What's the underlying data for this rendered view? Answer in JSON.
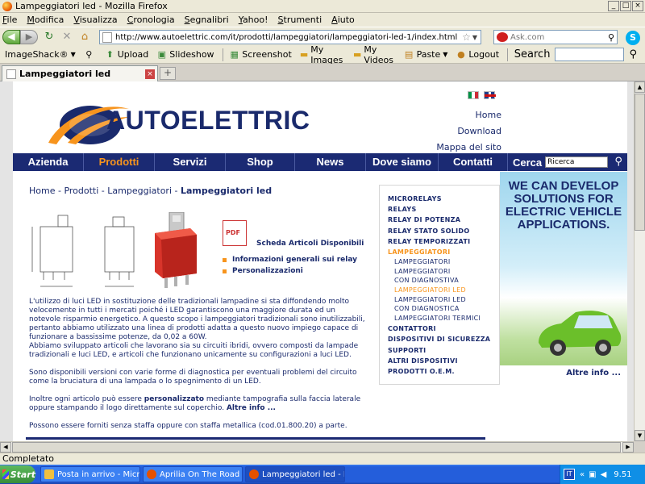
{
  "window": {
    "title": "Lampeggiatori led - Mozilla Firefox",
    "controls": [
      "_",
      "□",
      "×"
    ]
  },
  "menu": [
    "File",
    "Modifica",
    "Visualizza",
    "Cronologia",
    "Segnalibri",
    "Yahoo!",
    "Strumenti",
    "Aiuto"
  ],
  "nav": {
    "url": "http://www.autoelettric.com/it/prodotti/lampeggiatori/lampeggiatori-led-1/index.html",
    "ask_placeholder": "Ask.com"
  },
  "toolbar": {
    "items": [
      "ImageShack®",
      "Upload",
      "Slideshow",
      "Screenshot",
      "My Images",
      "My Videos",
      "Paste",
      "Logout"
    ],
    "search_label": "Search"
  },
  "tab": {
    "label": "Lampeggiatori led"
  },
  "site": {
    "logo_text": "AUTOELETTRIC",
    "top_links": [
      "Home",
      "Download",
      "Mappa del sito"
    ],
    "main_nav": [
      "Azienda",
      "Prodotti",
      "Servizi",
      "Shop",
      "News",
      "Dove siamo",
      "Contatti"
    ],
    "search_label": "Cerca",
    "search_value": "Ricerca",
    "breadcrumb": {
      "items": [
        "Home",
        "Prodotti",
        "Lampeggiatori"
      ],
      "current": "Lampeggiatori led",
      "sep": " - "
    },
    "scheda": "Scheda Articoli Disponibili",
    "bullets": [
      "Informazioni generali sui relay",
      "Personalizzazioni"
    ],
    "paragraphs": [
      "L'utilizzo di luci LED in sostituzione delle tradizionali lampadine si sta diffondendo molto velocemente in tutti i mercati poiché i LED garantiscono una maggiore durata ed un notevole risparmio energetico. A questo scopo i lampeggiatori tradizionali sono inutilizzabili, pertanto abbiamo utilizzato una linea di prodotti adatta a questo nuovo impiego capace di funzionare a bassissime potenze, da 0,02 a 60W.",
      "Abbiamo sviluppato articoli che lavorano sia su circuiti ibridi, ovvero composti da lampade tradizionali e luci LED, e articoli che funzionano unicamente su configurazioni a luci LED.",
      "Sono disponibili versioni con varie forme di diagnostica per eventuali problemi del circuito come la bruciatura di una lampada o lo spegnimento di un LED.",
      "Possono essere forniti senza staffa oppure con staffa metallica (cod.01.800.20) a parte."
    ],
    "para_pers": {
      "before": "Inoltre ogni articolo può essere ",
      "bold": "personalizzato",
      "after": " mediante tampografia sulla faccia laterale oppure stampando il logo direttamente sul coperchio. ",
      "link": "Altre info ..."
    },
    "side_menu": [
      {
        "label": "MICRORELAYS",
        "type": "main"
      },
      {
        "label": "RELAYS",
        "type": "main"
      },
      {
        "label": "RELAY DI POTENZA",
        "type": "main"
      },
      {
        "label": "RELAY STATO SOLIDO",
        "type": "main"
      },
      {
        "label": "RELAY TEMPORIZZATI",
        "type": "main"
      },
      {
        "label": "LAMPEGGIATORI",
        "type": "main-active"
      },
      {
        "label": "LAMPEGGIATORI",
        "type": "sub"
      },
      {
        "label": "LAMPEGGIATORI CON DIAGNOSTIVA",
        "type": "sub"
      },
      {
        "label": "LAMPEGGIATORI LED",
        "type": "sub-active"
      },
      {
        "label": "LAMPEGGIATORI LED CON DIAGNOSTICA",
        "type": "sub"
      },
      {
        "label": "LAMPEGGIATORI TERMICI",
        "type": "sub"
      },
      {
        "label": "CONTATTORI",
        "type": "main"
      },
      {
        "label": "DISPOSITIVI DI SICUREZZA",
        "type": "main"
      },
      {
        "label": "SUPPORTI",
        "type": "main"
      },
      {
        "label": "ALTRI DISPOSITIVI",
        "type": "main"
      },
      {
        "label": "PRODOTTI O.E.M.",
        "type": "main"
      }
    ],
    "ad": {
      "text": "WE CAN DEVELOP SOLUTIONS FOR ELECTRIC VEHICLE APPLICATIONS.",
      "more": "Altre info ..."
    }
  },
  "status": "Completato",
  "taskbar": {
    "start": "Start",
    "tasks": [
      "Posta in arrivo - Microsof...",
      "Aprilia On The Road • Mo...",
      "Lampeggiatori led - M..."
    ],
    "lang": "IT",
    "clock": "9.51"
  }
}
